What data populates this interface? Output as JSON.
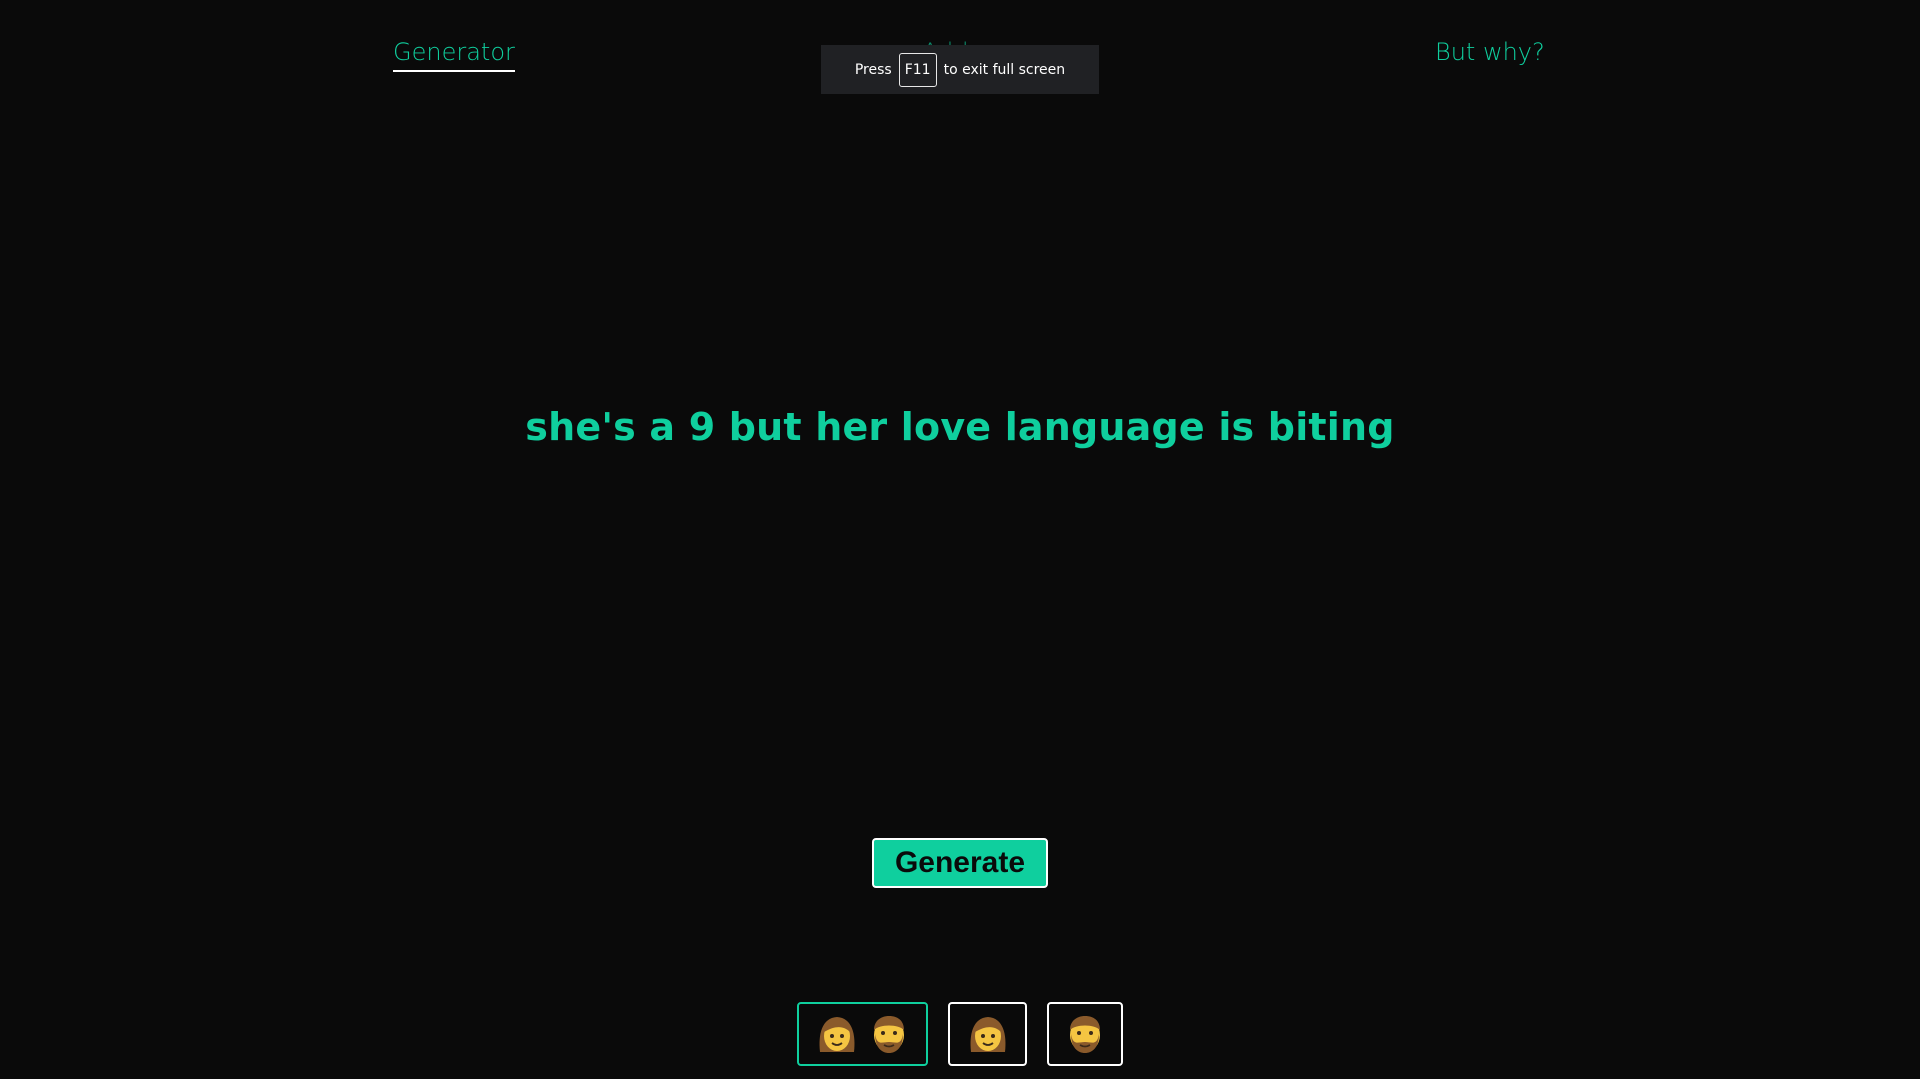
{
  "nav": {
    "generator_label": "Generator",
    "add_label": "Add one",
    "why_label": "But why?"
  },
  "fullscreen_notice": {
    "press": "Press",
    "key": "F11",
    "rest": "to exit full screen"
  },
  "headline": "she's a 9 but her love language is biting",
  "generate_label": "Generate",
  "modes": [
    {
      "name": "both",
      "icons": [
        "woman-face-icon",
        "man-face-icon"
      ],
      "selected": true
    },
    {
      "name": "her",
      "icons": [
        "woman-face-icon"
      ],
      "selected": false
    },
    {
      "name": "him",
      "icons": [
        "man-face-icon"
      ],
      "selected": false
    }
  ],
  "colors": {
    "background": "#0a0a0a",
    "accent": "#0fcf9e",
    "toast_bg": "#202124"
  }
}
